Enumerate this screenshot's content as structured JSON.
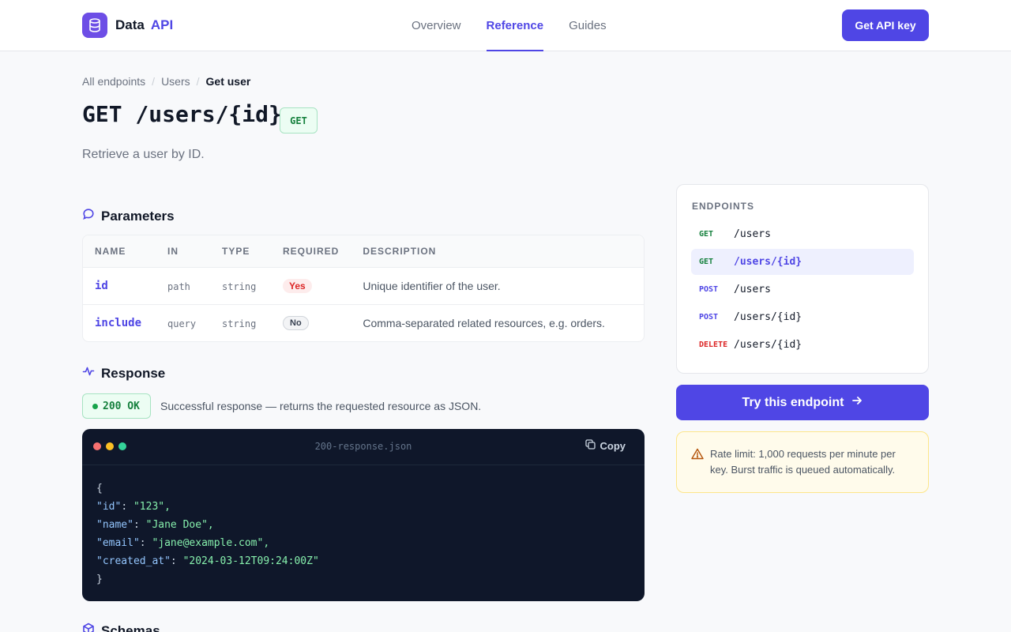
{
  "header": {
    "brand_word": "Data",
    "brand_accent": "API",
    "nav": [
      "Overview",
      "Reference",
      "Guides"
    ],
    "active_nav": "Reference",
    "cta_label": "Get API key"
  },
  "breadcrumb": [
    "All endpoints",
    "Users",
    "Get user"
  ],
  "endpoint": {
    "title": "GET /users/{id}",
    "method_badge": "GET",
    "description": "Retrieve a user by ID."
  },
  "parameters": {
    "heading": "Parameters",
    "columns": [
      "NAME",
      "IN",
      "TYPE",
      "REQUIRED",
      "DESCRIPTION"
    ],
    "rows": [
      {
        "name": "id",
        "in": "path",
        "type": "string",
        "required": "Yes",
        "description": "Unique identifier of the user."
      },
      {
        "name": "include",
        "in": "query",
        "type": "string",
        "required": "No",
        "description": "Comma-separated related resources, e.g. orders."
      }
    ]
  },
  "response": {
    "heading": "Response",
    "status": "200 OK",
    "status_text": "Successful response — returns the requested resource as JSON.",
    "filename": "200-response.json",
    "copy_label": "Copy",
    "open_brace": "{",
    "close_brace": "}",
    "fields": [
      {
        "key": "\"id\"",
        "value": "\"123\","
      },
      {
        "key": "\"name\"",
        "value": "\"Jane Doe\","
      },
      {
        "key": "\"email\"",
        "value": "\"jane@example.com\","
      },
      {
        "key": "\"created_at\"",
        "value": "\"2024-03-12T09:24:00Z\""
      }
    ]
  },
  "sidebar": {
    "heading": "ENDPOINTS",
    "items": [
      {
        "method": "GET",
        "path": "/users"
      },
      {
        "method": "GET",
        "path": "/users/{id}"
      },
      {
        "method": "POST",
        "path": "/users"
      },
      {
        "method": "POST",
        "path": "/users/{id}"
      },
      {
        "method": "DELETE",
        "path": "/users/{id}"
      }
    ],
    "active_index": 1,
    "try_label": "Try this endpoint",
    "notice": "Rate limit: 1,000 requests per minute per key. Burst traffic is queued automatically."
  },
  "next_section": "Schemas",
  "colors": {
    "accent": "#4f46e5",
    "success": "#15803d",
    "danger": "#dc2626",
    "code_bg": "#0f172a"
  },
  "icons": [
    "database-icon",
    "chat-bubble-icon",
    "activity-icon",
    "copy-icon",
    "arrow-right-icon",
    "warning-icon",
    "cube-icon"
  ]
}
